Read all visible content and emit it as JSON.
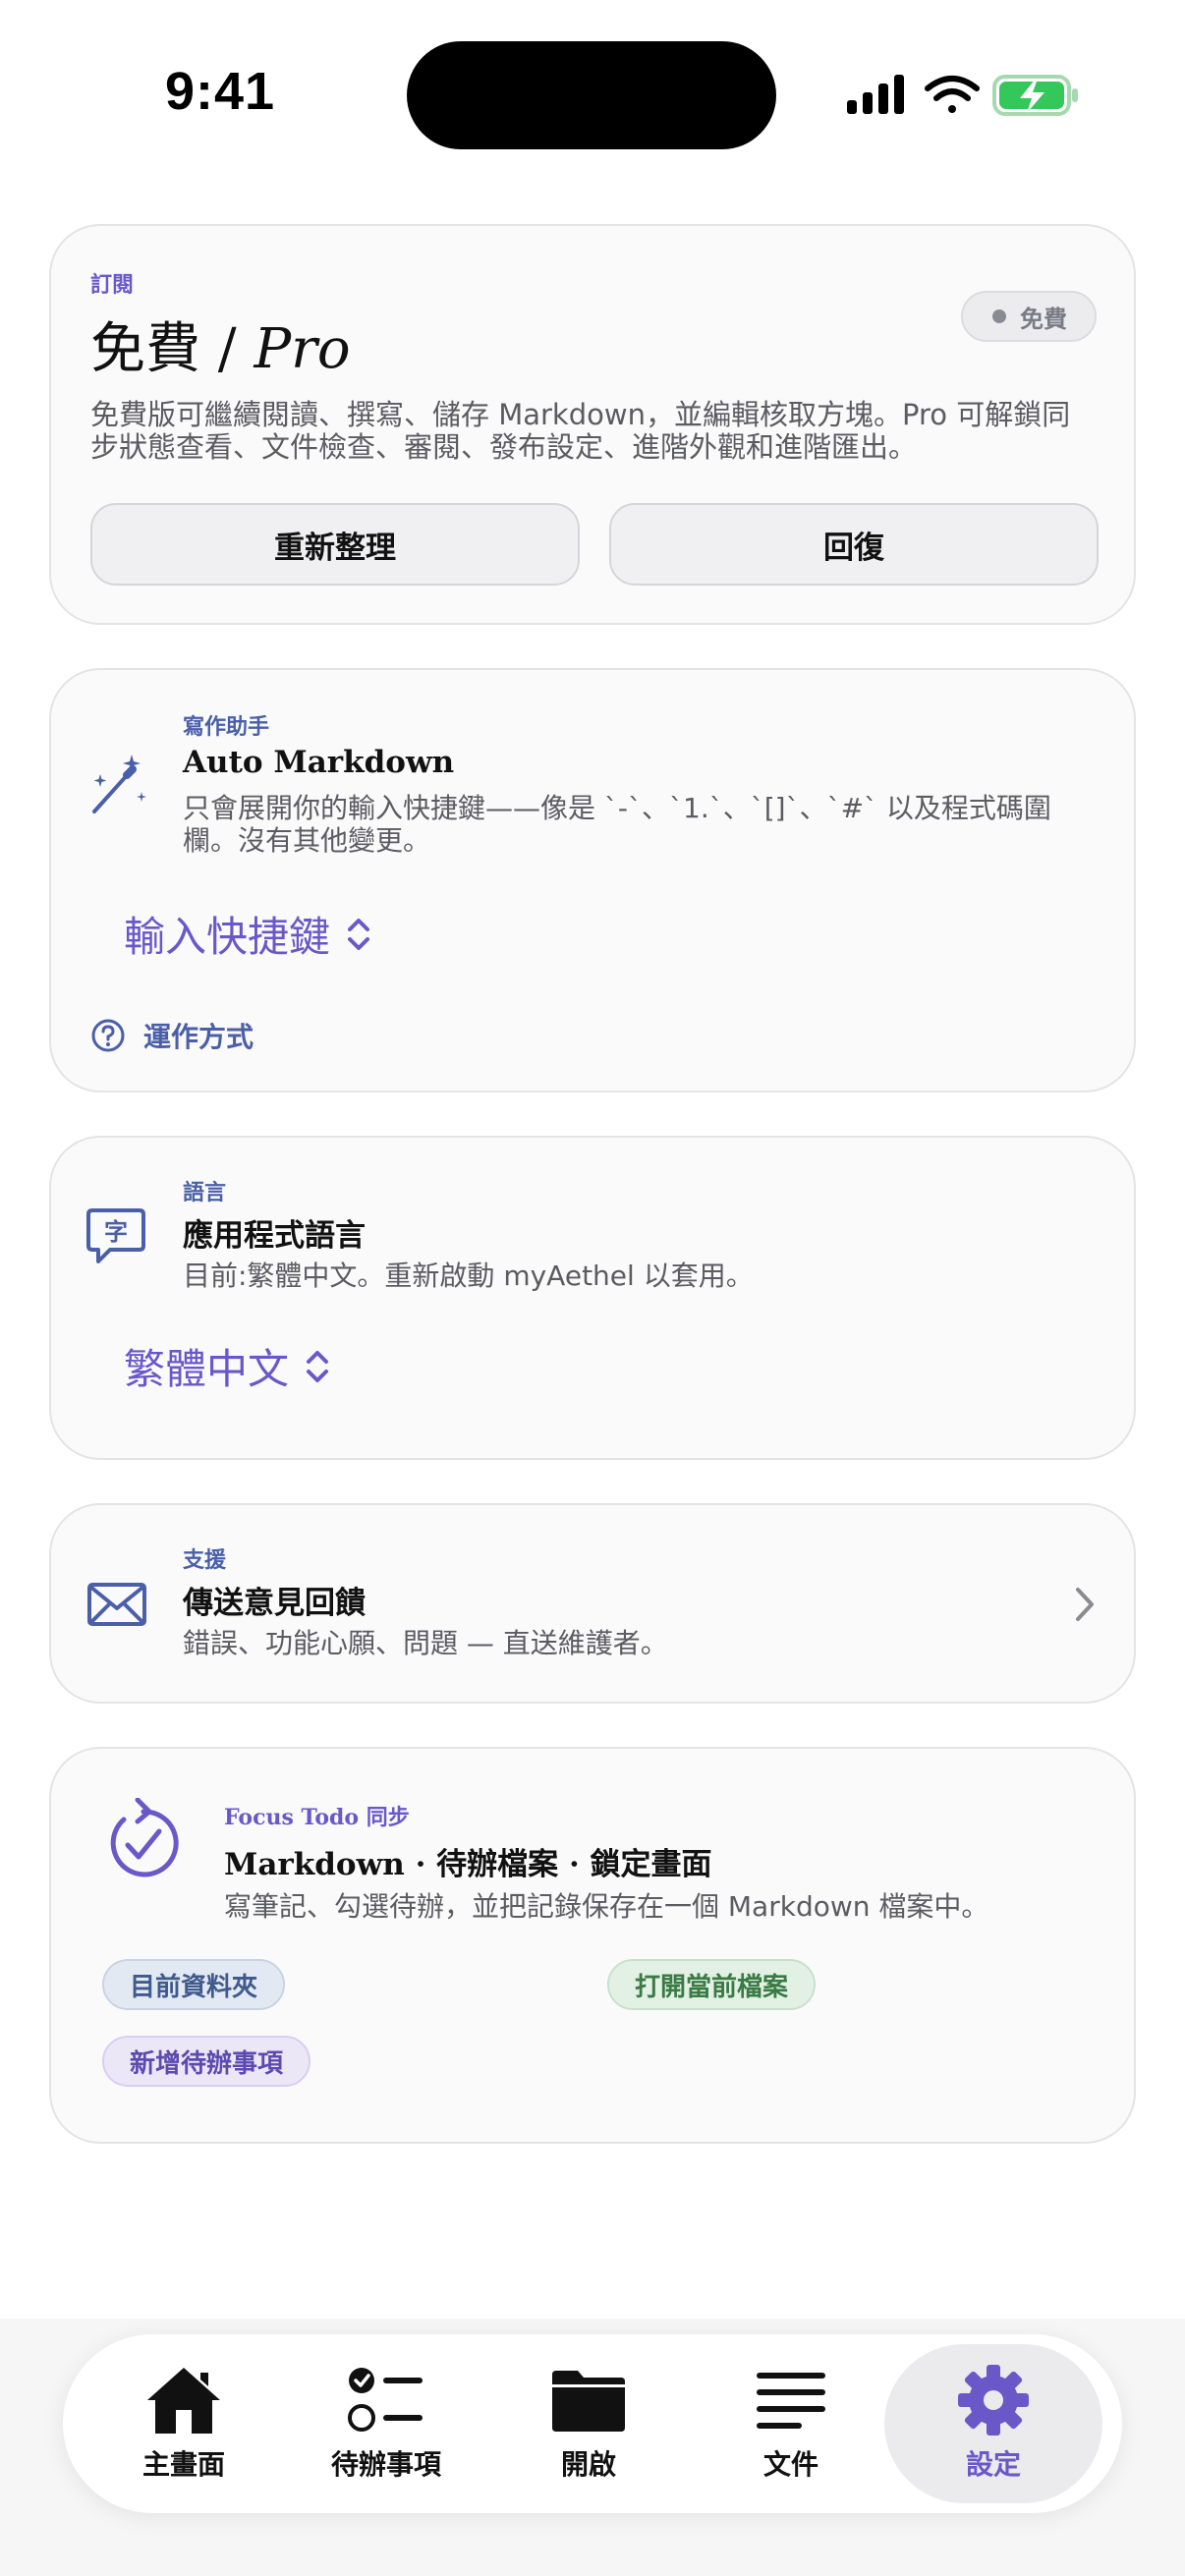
{
  "status_bar": {
    "time": "9:41"
  },
  "subscription": {
    "eyebrow": "訂閱",
    "title_cjk": "免費",
    "title_sep": " / ",
    "title_pro": "Pro",
    "badge": "免費",
    "description": "免費版可繼續閱讀、撰寫、儲存 Markdown，並編輯核取方塊。Pro 可解鎖同步狀態查看、文件檢查、審閱、發布設定、進階外觀和進階匯出。",
    "refresh_label": "重新整理",
    "restore_label": "回復"
  },
  "writing_assistant": {
    "eyebrow": "寫作助手",
    "title": "Auto Markdown",
    "description": "只會展開你的輸入快捷鍵——像是 `-`、`1.`、`[]`、`#` 以及程式碼圍欄。沒有其他變更。",
    "picker_value": "輸入快捷鍵",
    "help_label": "運作方式"
  },
  "language": {
    "eyebrow": "語言",
    "title": "應用程式語言",
    "description": "目前:繁體中文。重新啟動 myAethel 以套用。",
    "picker_value": "繁體中文"
  },
  "support": {
    "eyebrow": "支援",
    "title": "傳送意見回饋",
    "description": "錯誤、功能心願、問題 — 直送維護者。"
  },
  "focus_todo": {
    "eyebrow": "Focus Todo 同步",
    "title": "Markdown · 待辦檔案 · 鎖定畫面",
    "description": "寫筆記、勾選待辦，並把記錄保存在一個 Markdown 檔案中。",
    "chips": {
      "current_folder": "目前資料夾",
      "open_current_file": "打開當前檔案",
      "add_todo": "新增待辦事項"
    }
  },
  "tab_bar": {
    "home": "主畫面",
    "todos": "待辦事項",
    "open": "開啟",
    "documents": "文件",
    "settings": "設定"
  },
  "colors": {
    "accent": "#6a58c9",
    "link_blue": "#4a5fa8",
    "battery_green": "#34c759"
  }
}
